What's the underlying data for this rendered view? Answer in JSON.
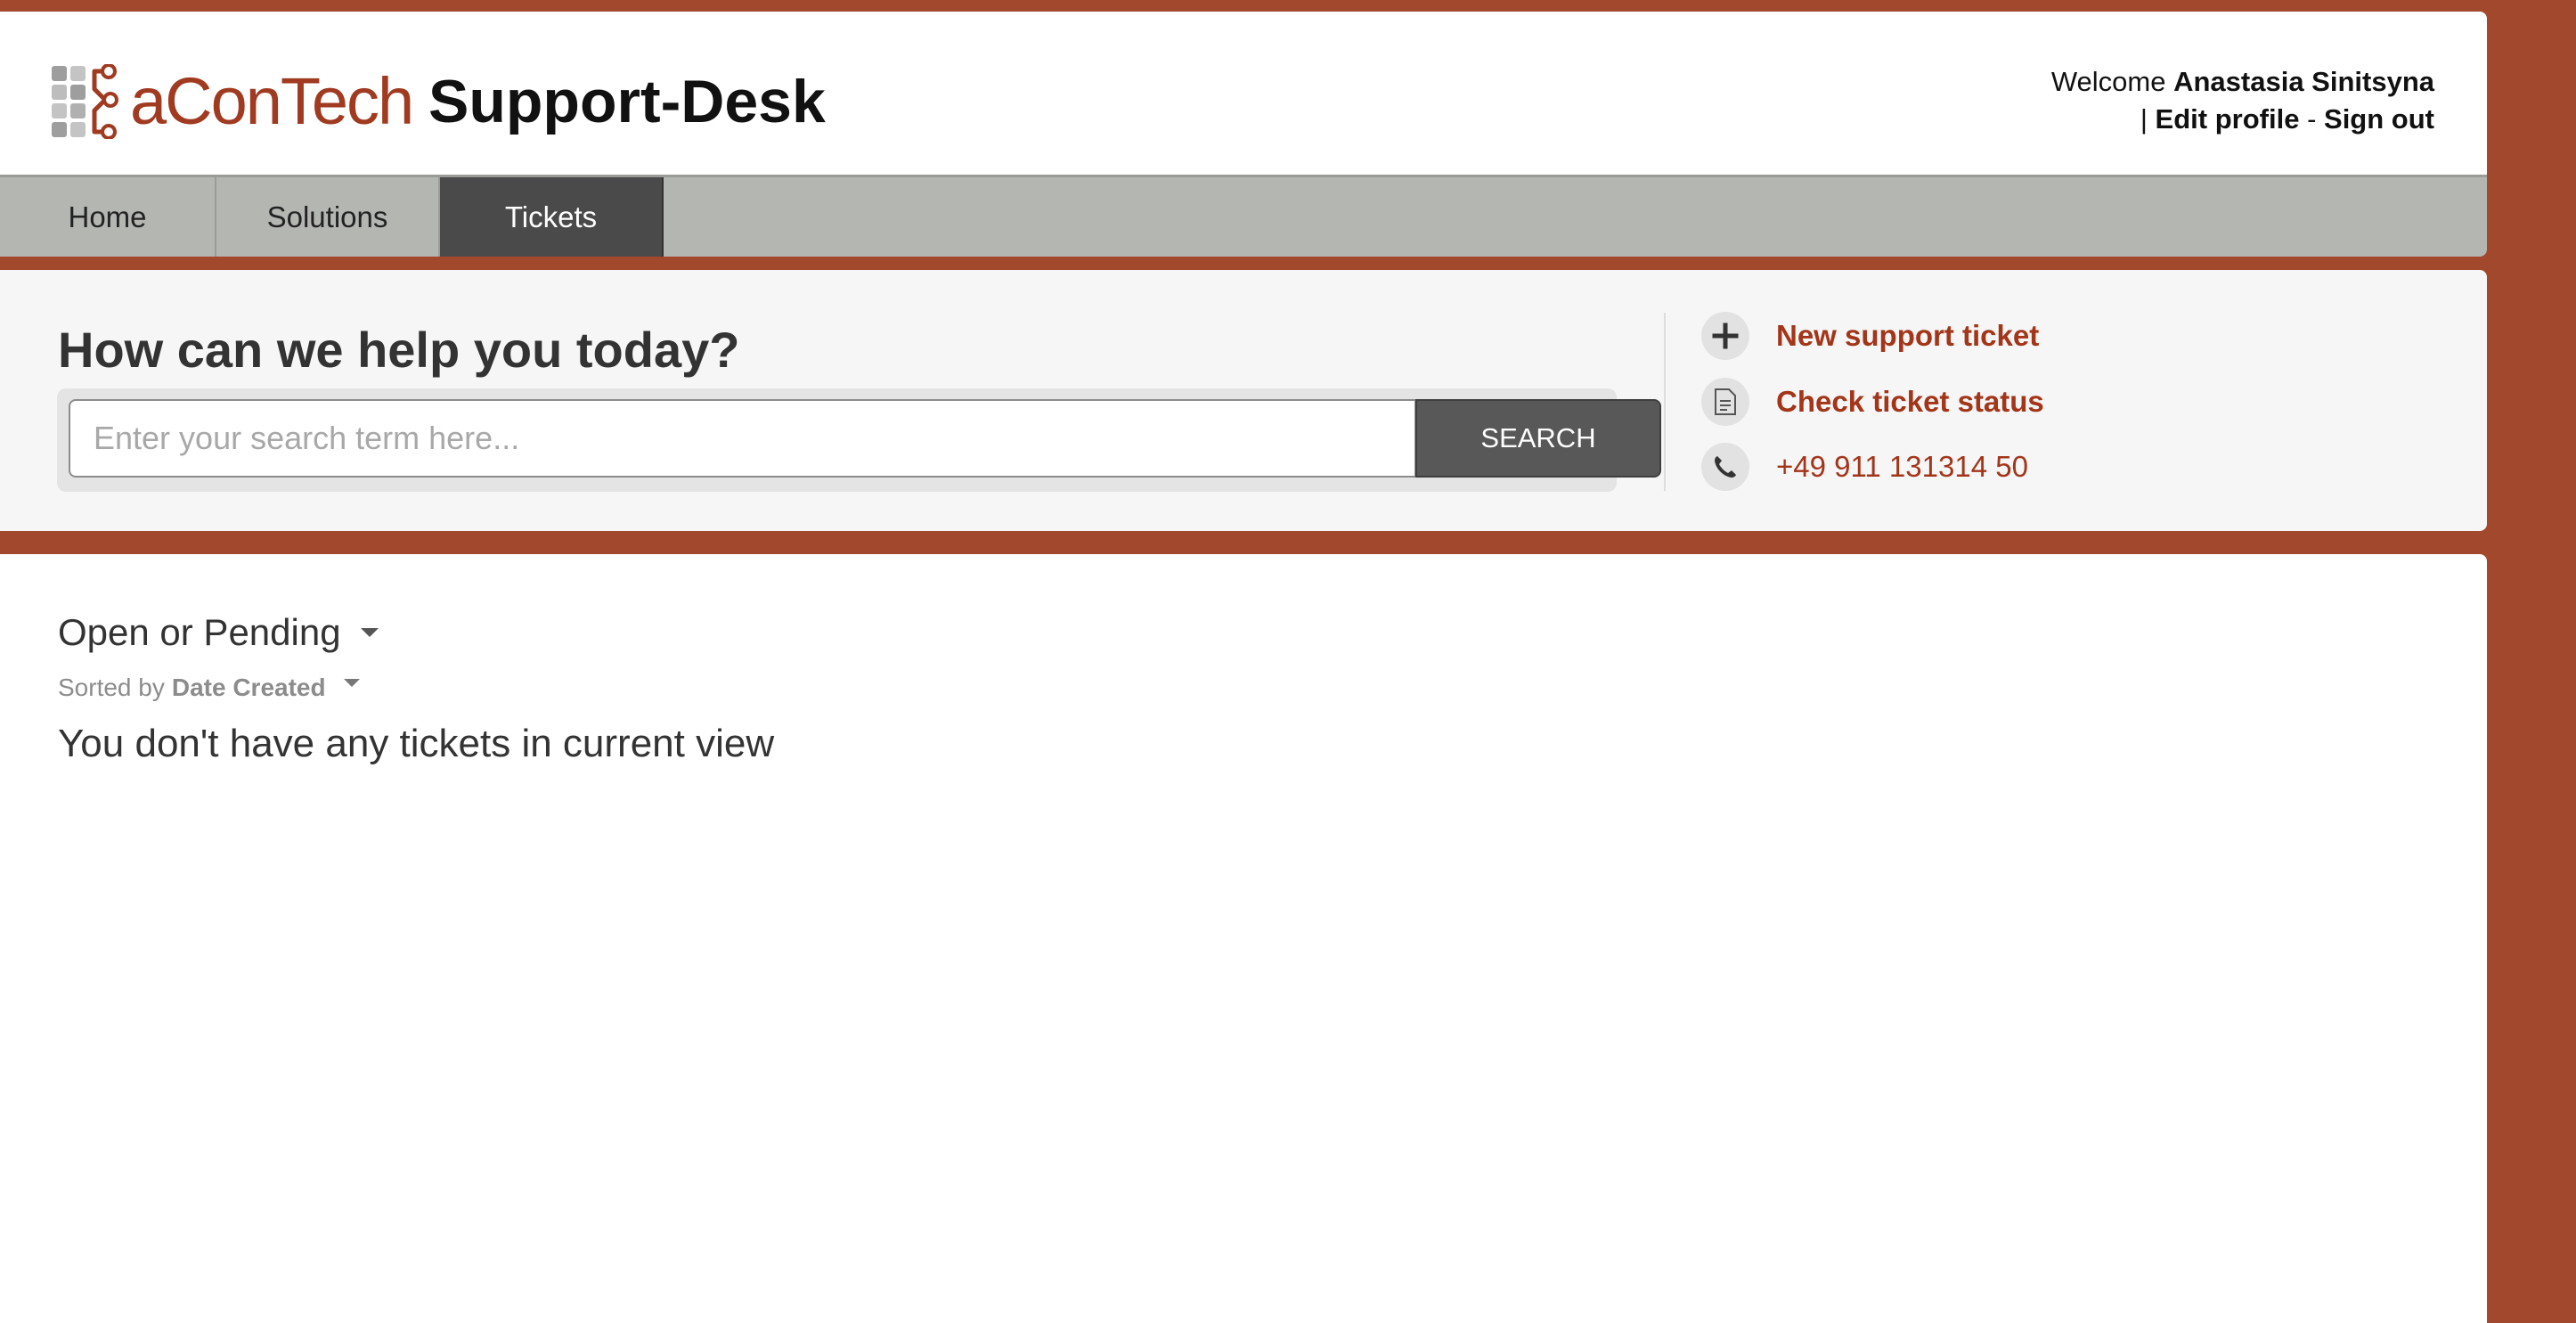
{
  "brand": {
    "logo_text": "aConTech",
    "site_title": "Support-Desk",
    "accent_color": "#a2482d",
    "link_color": "#a33519"
  },
  "user": {
    "welcome_label": "Welcome",
    "name": "Anastasia Sinitsyna",
    "separator": "|",
    "edit_profile": "Edit profile",
    "dash": "-",
    "sign_out": "Sign out"
  },
  "nav": {
    "items": [
      {
        "label": "Home",
        "active": false
      },
      {
        "label": "Solutions",
        "active": false
      },
      {
        "label": "Tickets",
        "active": true
      }
    ]
  },
  "help": {
    "heading": "How can we help you today?",
    "search_placeholder": "Enter your search term here...",
    "search_button": "SEARCH",
    "quick_links": [
      {
        "icon": "plus-icon",
        "label": "New support ticket"
      },
      {
        "icon": "document-icon",
        "label": "Check ticket status"
      },
      {
        "icon": "phone-icon",
        "label": "+49 911 131314 50"
      }
    ]
  },
  "tickets": {
    "filter_label": "Open or Pending",
    "sorted_by_label": "Sorted by",
    "sort_field": "Date Created",
    "empty_message": "You don't have any tickets in current view"
  }
}
